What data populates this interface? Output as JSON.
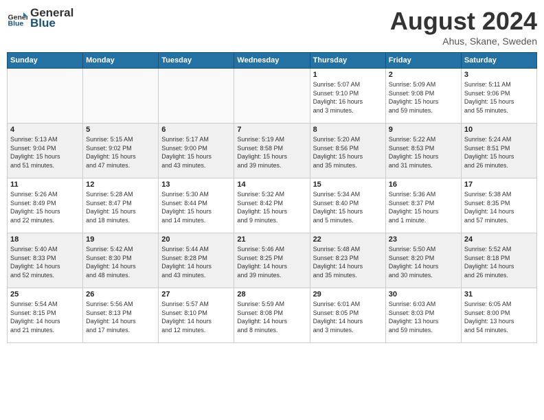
{
  "logo": {
    "general": "General",
    "blue": "Blue"
  },
  "title": {
    "month_year": "August 2024",
    "location": "Ahus, Skane, Sweden"
  },
  "days_of_week": [
    "Sunday",
    "Monday",
    "Tuesday",
    "Wednesday",
    "Thursday",
    "Friday",
    "Saturday"
  ],
  "weeks": [
    [
      {
        "day": "",
        "info": ""
      },
      {
        "day": "",
        "info": ""
      },
      {
        "day": "",
        "info": ""
      },
      {
        "day": "",
        "info": ""
      },
      {
        "day": "1",
        "info": "Sunrise: 5:07 AM\nSunset: 9:10 PM\nDaylight: 16 hours\nand 3 minutes."
      },
      {
        "day": "2",
        "info": "Sunrise: 5:09 AM\nSunset: 9:08 PM\nDaylight: 15 hours\nand 59 minutes."
      },
      {
        "day": "3",
        "info": "Sunrise: 5:11 AM\nSunset: 9:06 PM\nDaylight: 15 hours\nand 55 minutes."
      }
    ],
    [
      {
        "day": "4",
        "info": "Sunrise: 5:13 AM\nSunset: 9:04 PM\nDaylight: 15 hours\nand 51 minutes."
      },
      {
        "day": "5",
        "info": "Sunrise: 5:15 AM\nSunset: 9:02 PM\nDaylight: 15 hours\nand 47 minutes."
      },
      {
        "day": "6",
        "info": "Sunrise: 5:17 AM\nSunset: 9:00 PM\nDaylight: 15 hours\nand 43 minutes."
      },
      {
        "day": "7",
        "info": "Sunrise: 5:19 AM\nSunset: 8:58 PM\nDaylight: 15 hours\nand 39 minutes."
      },
      {
        "day": "8",
        "info": "Sunrise: 5:20 AM\nSunset: 8:56 PM\nDaylight: 15 hours\nand 35 minutes."
      },
      {
        "day": "9",
        "info": "Sunrise: 5:22 AM\nSunset: 8:53 PM\nDaylight: 15 hours\nand 31 minutes."
      },
      {
        "day": "10",
        "info": "Sunrise: 5:24 AM\nSunset: 8:51 PM\nDaylight: 15 hours\nand 26 minutes."
      }
    ],
    [
      {
        "day": "11",
        "info": "Sunrise: 5:26 AM\nSunset: 8:49 PM\nDaylight: 15 hours\nand 22 minutes."
      },
      {
        "day": "12",
        "info": "Sunrise: 5:28 AM\nSunset: 8:47 PM\nDaylight: 15 hours\nand 18 minutes."
      },
      {
        "day": "13",
        "info": "Sunrise: 5:30 AM\nSunset: 8:44 PM\nDaylight: 15 hours\nand 14 minutes."
      },
      {
        "day": "14",
        "info": "Sunrise: 5:32 AM\nSunset: 8:42 PM\nDaylight: 15 hours\nand 9 minutes."
      },
      {
        "day": "15",
        "info": "Sunrise: 5:34 AM\nSunset: 8:40 PM\nDaylight: 15 hours\nand 5 minutes."
      },
      {
        "day": "16",
        "info": "Sunrise: 5:36 AM\nSunset: 8:37 PM\nDaylight: 15 hours\nand 1 minute."
      },
      {
        "day": "17",
        "info": "Sunrise: 5:38 AM\nSunset: 8:35 PM\nDaylight: 14 hours\nand 57 minutes."
      }
    ],
    [
      {
        "day": "18",
        "info": "Sunrise: 5:40 AM\nSunset: 8:33 PM\nDaylight: 14 hours\nand 52 minutes."
      },
      {
        "day": "19",
        "info": "Sunrise: 5:42 AM\nSunset: 8:30 PM\nDaylight: 14 hours\nand 48 minutes."
      },
      {
        "day": "20",
        "info": "Sunrise: 5:44 AM\nSunset: 8:28 PM\nDaylight: 14 hours\nand 43 minutes."
      },
      {
        "day": "21",
        "info": "Sunrise: 5:46 AM\nSunset: 8:25 PM\nDaylight: 14 hours\nand 39 minutes."
      },
      {
        "day": "22",
        "info": "Sunrise: 5:48 AM\nSunset: 8:23 PM\nDaylight: 14 hours\nand 35 minutes."
      },
      {
        "day": "23",
        "info": "Sunrise: 5:50 AM\nSunset: 8:20 PM\nDaylight: 14 hours\nand 30 minutes."
      },
      {
        "day": "24",
        "info": "Sunrise: 5:52 AM\nSunset: 8:18 PM\nDaylight: 14 hours\nand 26 minutes."
      }
    ],
    [
      {
        "day": "25",
        "info": "Sunrise: 5:54 AM\nSunset: 8:15 PM\nDaylight: 14 hours\nand 21 minutes."
      },
      {
        "day": "26",
        "info": "Sunrise: 5:56 AM\nSunset: 8:13 PM\nDaylight: 14 hours\nand 17 minutes."
      },
      {
        "day": "27",
        "info": "Sunrise: 5:57 AM\nSunset: 8:10 PM\nDaylight: 14 hours\nand 12 minutes."
      },
      {
        "day": "28",
        "info": "Sunrise: 5:59 AM\nSunset: 8:08 PM\nDaylight: 14 hours\nand 8 minutes."
      },
      {
        "day": "29",
        "info": "Sunrise: 6:01 AM\nSunset: 8:05 PM\nDaylight: 14 hours\nand 3 minutes."
      },
      {
        "day": "30",
        "info": "Sunrise: 6:03 AM\nSunset: 8:03 PM\nDaylight: 13 hours\nand 59 minutes."
      },
      {
        "day": "31",
        "info": "Sunrise: 6:05 AM\nSunset: 8:00 PM\nDaylight: 13 hours\nand 54 minutes."
      }
    ]
  ]
}
